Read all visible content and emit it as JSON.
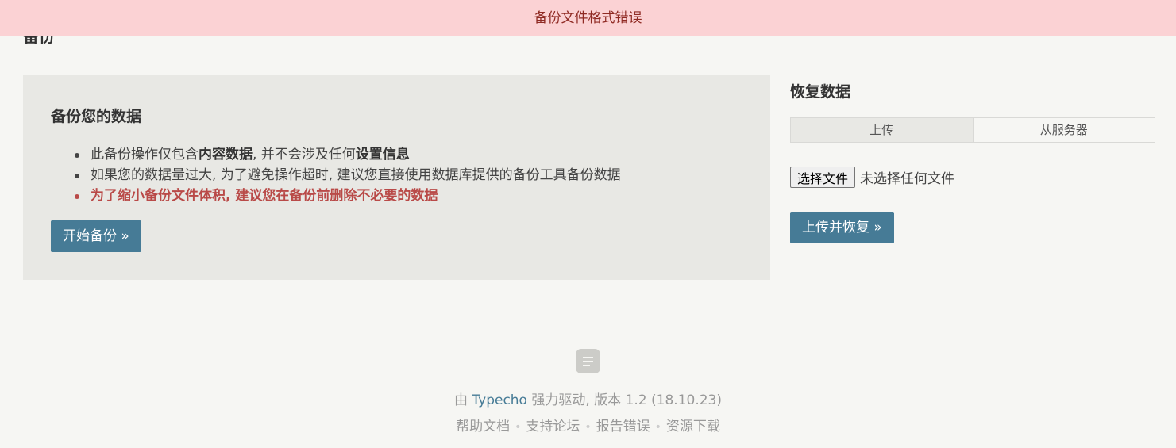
{
  "notice": {
    "text": "备份文件格式错误"
  },
  "page": {
    "title": "备份"
  },
  "backup": {
    "heading": "备份您的数据",
    "items": [
      {
        "prefix": "此备份操作仅包含",
        "bold1": "内容数据",
        "middle": ", 并不会涉及任何",
        "bold2": "设置信息"
      },
      {
        "text": "如果您的数据量过大, 为了避免操作超时, 建议您直接使用数据库提供的备份工具备份数据"
      },
      {
        "text": "为了缩小备份文件体积, 建议您在备份前删除不必要的数据"
      }
    ],
    "start_button": "开始备份 »"
  },
  "restore": {
    "heading": "恢复数据",
    "tabs": [
      {
        "label": "上传"
      },
      {
        "label": "从服务器"
      }
    ],
    "file_button": "选择文件",
    "file_status": "未选择任何文件",
    "upload_button": "上传并恢复 »"
  },
  "footer": {
    "power_prefix": "由",
    "power_link": "Typecho",
    "power_suffix": "强力驱动, 版本 1.2 (18.10.23)",
    "links": [
      "帮助文档",
      "支持论坛",
      "报告错误",
      "资源下载"
    ]
  },
  "colors": {
    "accent": "#467b96",
    "notice_bg": "#fbd2d4",
    "notice_text": "#8f2a23",
    "warn": "#b94a48"
  }
}
